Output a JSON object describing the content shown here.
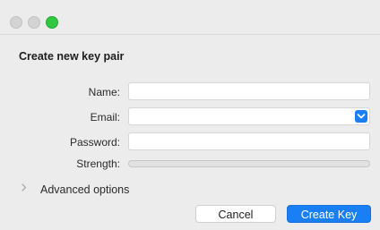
{
  "dialog": {
    "heading": "Create new key pair",
    "fields": {
      "name": {
        "label": "Name:",
        "value": ""
      },
      "email": {
        "label": "Email:",
        "value": ""
      },
      "password": {
        "label": "Password:",
        "value": ""
      },
      "strength": {
        "label": "Strength:",
        "level": 0
      }
    },
    "advanced": {
      "label": "Advanced options",
      "icon": "chevron-right-icon"
    },
    "buttons": {
      "cancel": "Cancel",
      "create": "Create Key"
    }
  },
  "colors": {
    "accent": "#1a7ef5",
    "window_bg": "#ececec",
    "zoom_green": "#2fc840"
  }
}
